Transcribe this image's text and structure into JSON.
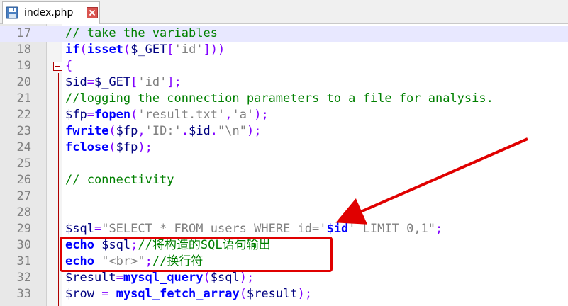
{
  "tab": {
    "label": "index.php"
  },
  "lines": [
    {
      "num": "17",
      "parts": [
        [
          "cm",
          "// take the variables"
        ]
      ]
    },
    {
      "num": "18",
      "parts": [
        [
          "kw",
          "if"
        ],
        [
          "op",
          "("
        ],
        [
          "kw",
          "isset"
        ],
        [
          "op",
          "("
        ],
        [
          "var",
          "$_GET"
        ],
        [
          "op",
          "["
        ],
        [
          "str",
          "'id'"
        ],
        [
          "op",
          "]))"
        ]
      ]
    },
    {
      "num": "19",
      "parts": [
        [
          "op",
          "{"
        ]
      ]
    },
    {
      "num": "20",
      "parts": [
        [
          "var",
          "$id"
        ],
        [
          "op",
          "="
        ],
        [
          "var",
          "$_GET"
        ],
        [
          "op",
          "["
        ],
        [
          "str",
          "'id'"
        ],
        [
          "op",
          "];"
        ]
      ]
    },
    {
      "num": "21",
      "parts": [
        [
          "cm",
          "//logging the connection parameters to a file for analysis."
        ]
      ]
    },
    {
      "num": "22",
      "parts": [
        [
          "var",
          "$fp"
        ],
        [
          "op",
          "="
        ],
        [
          "kw",
          "fopen"
        ],
        [
          "op",
          "("
        ],
        [
          "str",
          "'result.txt'"
        ],
        [
          "op",
          ","
        ],
        [
          "str",
          "'a'"
        ],
        [
          "op",
          ");"
        ]
      ]
    },
    {
      "num": "23",
      "parts": [
        [
          "kw",
          "fwrite"
        ],
        [
          "op",
          "("
        ],
        [
          "var",
          "$fp"
        ],
        [
          "op",
          ","
        ],
        [
          "str",
          "'ID:'"
        ],
        [
          "op",
          "."
        ],
        [
          "var",
          "$id"
        ],
        [
          "op",
          "."
        ],
        [
          "str",
          "\"\\n\""
        ],
        [
          "op",
          ");"
        ]
      ]
    },
    {
      "num": "24",
      "parts": [
        [
          "kw",
          "fclose"
        ],
        [
          "op",
          "("
        ],
        [
          "var",
          "$fp"
        ],
        [
          "op",
          ");"
        ]
      ]
    },
    {
      "num": "25",
      "parts": []
    },
    {
      "num": "26",
      "parts": [
        [
          "cm",
          "// connectivity"
        ]
      ]
    },
    {
      "num": "27",
      "parts": []
    },
    {
      "num": "28",
      "parts": []
    },
    {
      "num": "29",
      "parts": [
        [
          "var",
          "$sql"
        ],
        [
          "op",
          "="
        ],
        [
          "str",
          "\"SELECT * FROM users WHERE id='"
        ],
        [
          "kw",
          "$id"
        ],
        [
          "str",
          "' LIMIT 0,1\""
        ],
        [
          "op",
          ";"
        ]
      ]
    },
    {
      "num": "30",
      "parts": [
        [
          "kw",
          "echo"
        ],
        [
          "plain",
          " "
        ],
        [
          "var",
          "$sql"
        ],
        [
          "op",
          ";"
        ],
        [
          "cm",
          "//将构造的SQL语句输出"
        ]
      ]
    },
    {
      "num": "31",
      "parts": [
        [
          "kw",
          "echo"
        ],
        [
          "plain",
          " "
        ],
        [
          "str",
          "\"<br>\""
        ],
        [
          "op",
          ";"
        ],
        [
          "cm",
          "//换行符"
        ]
      ]
    },
    {
      "num": "32",
      "parts": [
        [
          "var",
          "$result"
        ],
        [
          "op",
          "="
        ],
        [
          "kw",
          "mysql_query"
        ],
        [
          "op",
          "("
        ],
        [
          "var",
          "$sql"
        ],
        [
          "op",
          ");"
        ]
      ]
    },
    {
      "num": "33",
      "parts": [
        [
          "var",
          "$row"
        ],
        [
          "plain",
          " "
        ],
        [
          "op",
          "="
        ],
        [
          "plain",
          " "
        ],
        [
          "kw",
          "mysql_fetch_array"
        ],
        [
          "op",
          "("
        ],
        [
          "var",
          "$result"
        ],
        [
          "op",
          ");"
        ]
      ]
    }
  ],
  "highlight_line": "17",
  "colors": {
    "annotation": "#e00000",
    "comment": "#008000",
    "keyword": "#0000ff"
  }
}
